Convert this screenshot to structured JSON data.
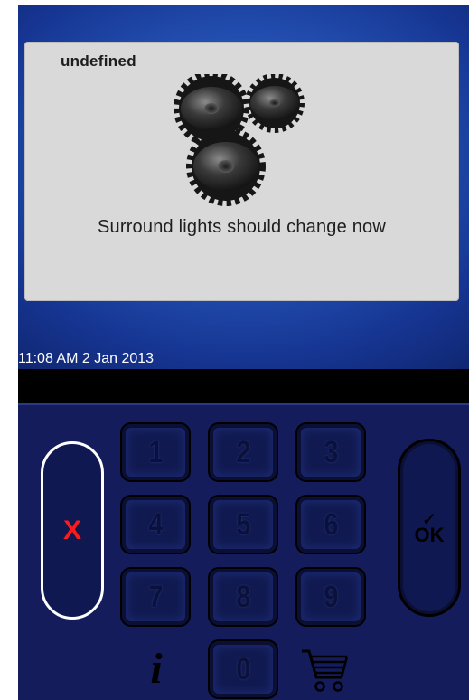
{
  "dialog": {
    "title": "undefined",
    "message": "Surround lights should change now",
    "image": "gears-icon"
  },
  "status": {
    "datetime": "11:08 AM 2 Jan 2013"
  },
  "keypad": {
    "keys": [
      "1",
      "2",
      "3",
      "4",
      "5",
      "6",
      "7",
      "8",
      "9",
      "0"
    ],
    "cancel_label": "X",
    "ok_check": "✓",
    "ok_label": "OK",
    "info_icon": "info-icon",
    "info_glyph": "i",
    "cart_icon": "shopping-cart-icon"
  },
  "colors": {
    "screen_background": "#2452b4",
    "keypad_background": "#141c5c",
    "dialog_background": "#d9d9d9",
    "cancel_red": "#ff1a1a"
  }
}
